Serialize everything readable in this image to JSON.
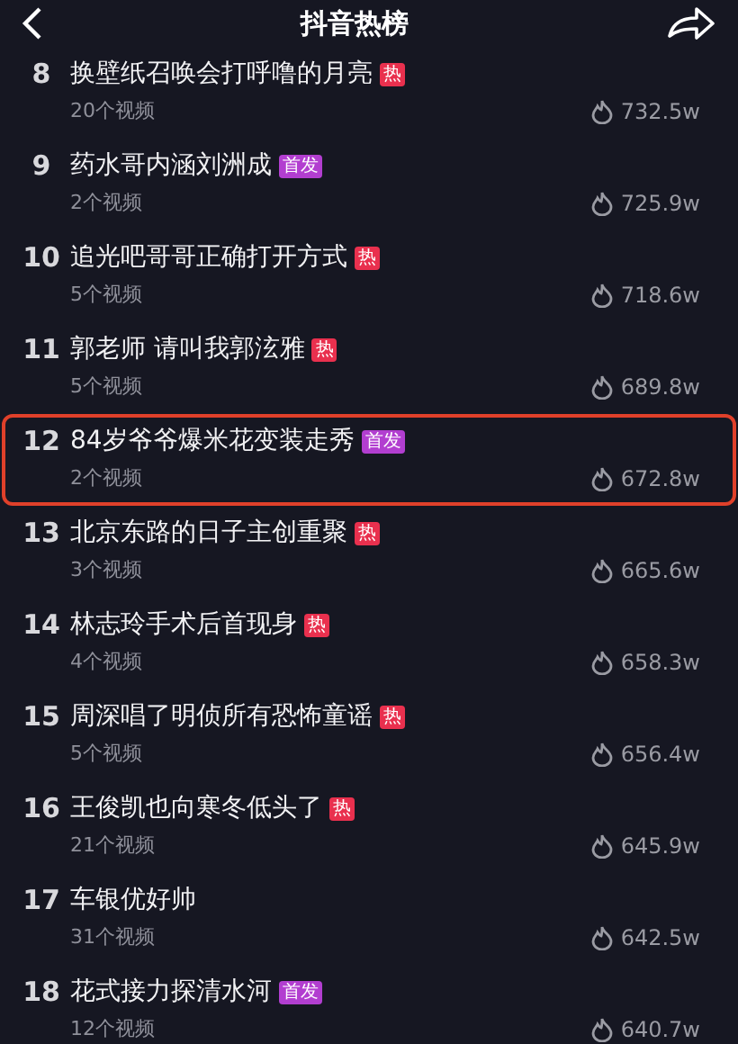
{
  "header": {
    "title": "抖音热榜"
  },
  "items": [
    {
      "rank": "8",
      "title": "换壁纸召唤会打呼噜的月亮",
      "badge": {
        "kind": "hot",
        "label": "热"
      },
      "videos": "20个视频",
      "heat": "732.5w",
      "highlighted": false
    },
    {
      "rank": "9",
      "title": "药水哥内涵刘洲成",
      "badge": {
        "kind": "new",
        "label": "首发"
      },
      "videos": "2个视频",
      "heat": "725.9w",
      "highlighted": false
    },
    {
      "rank": "10",
      "title": "追光吧哥哥正确打开方式",
      "badge": {
        "kind": "hot",
        "label": "热"
      },
      "videos": "5个视频",
      "heat": "718.6w",
      "highlighted": false
    },
    {
      "rank": "11",
      "title": "郭老师 请叫我郭泫雅",
      "badge": {
        "kind": "hot",
        "label": "热"
      },
      "videos": "5个视频",
      "heat": "689.8w",
      "highlighted": false
    },
    {
      "rank": "12",
      "title": "84岁爷爷爆米花变装走秀",
      "badge": {
        "kind": "new",
        "label": "首发"
      },
      "videos": "2个视频",
      "heat": "672.8w",
      "highlighted": true
    },
    {
      "rank": "13",
      "title": "北京东路的日子主创重聚",
      "badge": {
        "kind": "hot",
        "label": "热"
      },
      "videos": "3个视频",
      "heat": "665.6w",
      "highlighted": false
    },
    {
      "rank": "14",
      "title": "林志玲手术后首现身",
      "badge": {
        "kind": "hot",
        "label": "热"
      },
      "videos": "4个视频",
      "heat": "658.3w",
      "highlighted": false
    },
    {
      "rank": "15",
      "title": "周深唱了明侦所有恐怖童谣",
      "badge": {
        "kind": "hot",
        "label": "热"
      },
      "videos": "5个视频",
      "heat": "656.4w",
      "highlighted": false
    },
    {
      "rank": "16",
      "title": "王俊凯也向寒冬低头了",
      "badge": {
        "kind": "hot",
        "label": "热"
      },
      "videos": "21个视频",
      "heat": "645.9w",
      "highlighted": false
    },
    {
      "rank": "17",
      "title": "车银优好帅",
      "videos": "31个视频",
      "heat": "642.5w",
      "highlighted": false
    },
    {
      "rank": "18",
      "title": "花式接力探清水河",
      "badge": {
        "kind": "new",
        "label": "首发"
      },
      "videos": "12个视频",
      "heat": "640.7w",
      "highlighted": false
    }
  ]
}
